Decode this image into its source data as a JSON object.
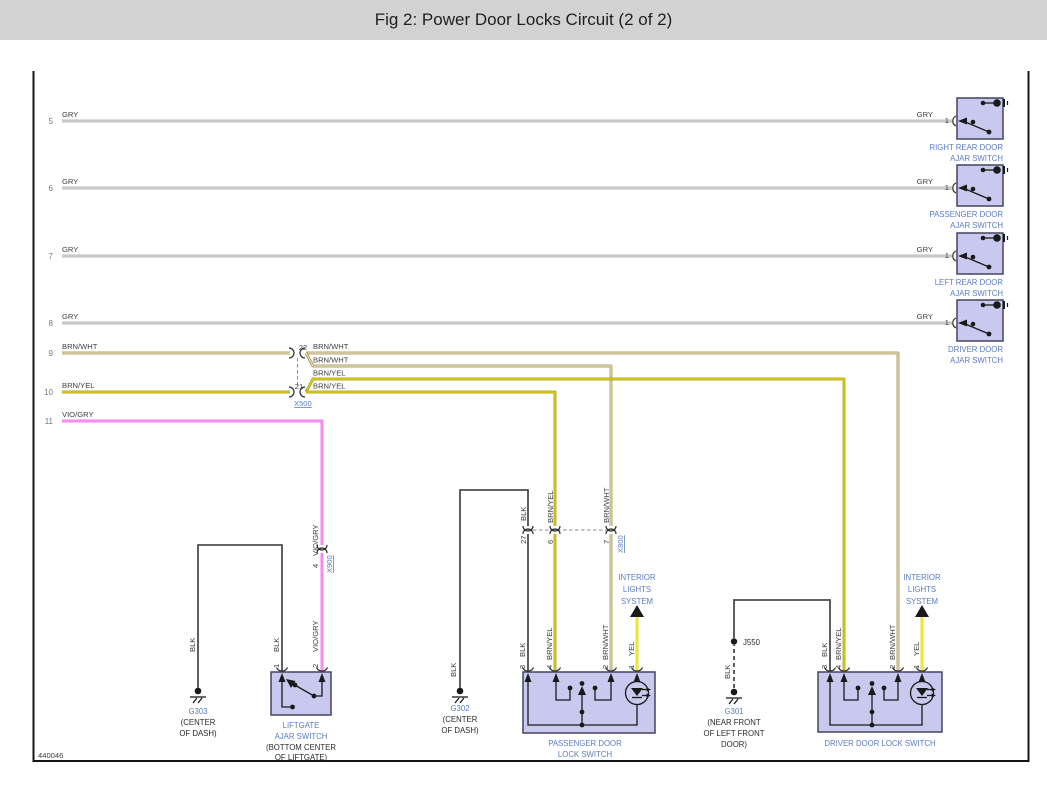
{
  "title": "Fig 2: Power Door Locks Circuit (2 of 2)",
  "footer_id": "440046",
  "colors": {
    "accent_blue": "#5b7cc4",
    "box_fill": "#c9c9ef",
    "gry": "#b5b5b5",
    "brn_wht": "#97843a",
    "brn_yel": "#9a8a05",
    "vio_gry": "#ea53ea",
    "blk": "#4d4d4d",
    "yel": "#f0e000"
  },
  "left_rows": [
    {
      "num": "5",
      "wire": "GRY"
    },
    {
      "num": "6",
      "wire": "GRY"
    },
    {
      "num": "7",
      "wire": "GRY"
    },
    {
      "num": "8",
      "wire": "GRY"
    },
    {
      "num": "9",
      "wire": "BRN/WHT"
    },
    {
      "num": "10",
      "wire": "BRN/YEL"
    },
    {
      "num": "11",
      "wire": "VIO/GRY"
    }
  ],
  "ajar_switches": [
    {
      "wire": "GRY",
      "pin": "1",
      "line1": "RIGHT REAR DOOR",
      "line2": "AJAR SWITCH"
    },
    {
      "wire": "GRY",
      "pin": "1",
      "line1": "PASSENGER DOOR",
      "line2": "AJAR SWITCH"
    },
    {
      "wire": "GRY",
      "pin": "1",
      "line1": "LEFT REAR DOOR",
      "line2": "AJAR SWITCH"
    },
    {
      "wire": "GRY",
      "pin": "1",
      "line1": "DRIVER DOOR",
      "line2": "AJAR SWITCH"
    }
  ],
  "x500": {
    "name": "X500",
    "pin_top": "22",
    "pin_bottom": "21",
    "wire_top1": "BRN/WHT",
    "wire_top2": "BRN/WHT",
    "wire_bottom1": "BRN/YEL",
    "wire_bottom2": "BRN/YEL"
  },
  "x900": {
    "name": "X900",
    "pin": "4",
    "wire": "VIO/GRY"
  },
  "x800": {
    "name": "X800",
    "pin1": "27",
    "pin2": "6",
    "pin3": "7",
    "wire1": "BLK",
    "wire2": "BRN/YEL",
    "wire3": "BRN/WHT"
  },
  "g303": {
    "name": "G303",
    "loc1": "(CENTER",
    "loc2": "OF DASH)",
    "wire": "BLK"
  },
  "g302": {
    "name": "G302",
    "loc1": "(CENTER",
    "loc2": "OF DASH)",
    "wire": "BLK"
  },
  "g301": {
    "name": "G301",
    "loc1": "(NEAR FRONT",
    "loc2": "OF LEFT FRONT",
    "loc3": "DOOR)",
    "wire": "BLK"
  },
  "j550": {
    "name": "J550"
  },
  "liftgate": {
    "pin1": "1",
    "pin2": "2",
    "wire1": "BLK",
    "wire2": "VIO/GRY",
    "name1": "LIFTGATE",
    "name2": "AJAR SWITCH",
    "loc1": "(BOTTOM CENTER",
    "loc2": "OF LIFTGATE)"
  },
  "passenger_lock": {
    "pin1": "3",
    "pin2": "4",
    "pin3": "2",
    "pin4": "1",
    "wire1": "BLK",
    "wire2": "BRN/YEL",
    "wire3": "BRN/WHT",
    "wire4": "YEL",
    "name1": "PASSENGER DOOR",
    "name2": "LOCK SWITCH"
  },
  "driver_lock": {
    "pin1": "3",
    "pin2": "4",
    "pin3": "2",
    "pin4": "1",
    "wire1": "BLK",
    "wire2": "BRN/YEL",
    "wire3": "BRN/WHT",
    "wire4": "YEL",
    "name": "DRIVER DOOR LOCK SWITCH"
  },
  "interior_lights": {
    "line1": "INTERIOR",
    "line2": "LIGHTS",
    "line3": "SYSTEM"
  }
}
